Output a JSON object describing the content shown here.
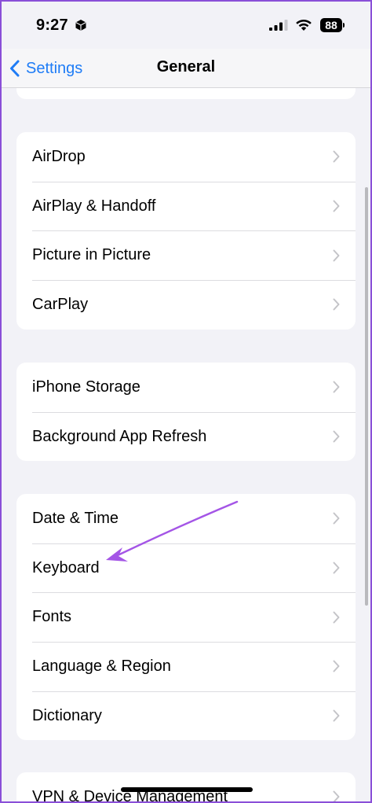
{
  "status_bar": {
    "time": "9:27",
    "battery": "88",
    "icons": [
      "cube-icon",
      "signal-icon",
      "wifi-icon",
      "battery-icon"
    ]
  },
  "nav": {
    "back_label": "Settings",
    "title": "General"
  },
  "groups": [
    {
      "items": [
        "AirDrop",
        "AirPlay & Handoff",
        "Picture in Picture",
        "CarPlay"
      ]
    },
    {
      "items": [
        "iPhone Storage",
        "Background App Refresh"
      ]
    },
    {
      "items": [
        "Date & Time",
        "Keyboard",
        "Fonts",
        "Language & Region",
        "Dictionary"
      ]
    },
    {
      "items": [
        "VPN & Device Management"
      ]
    }
  ],
  "colors": {
    "accent": "#1e7cf6",
    "annotation": "#a455e6",
    "frame": "#8a4fd8"
  }
}
